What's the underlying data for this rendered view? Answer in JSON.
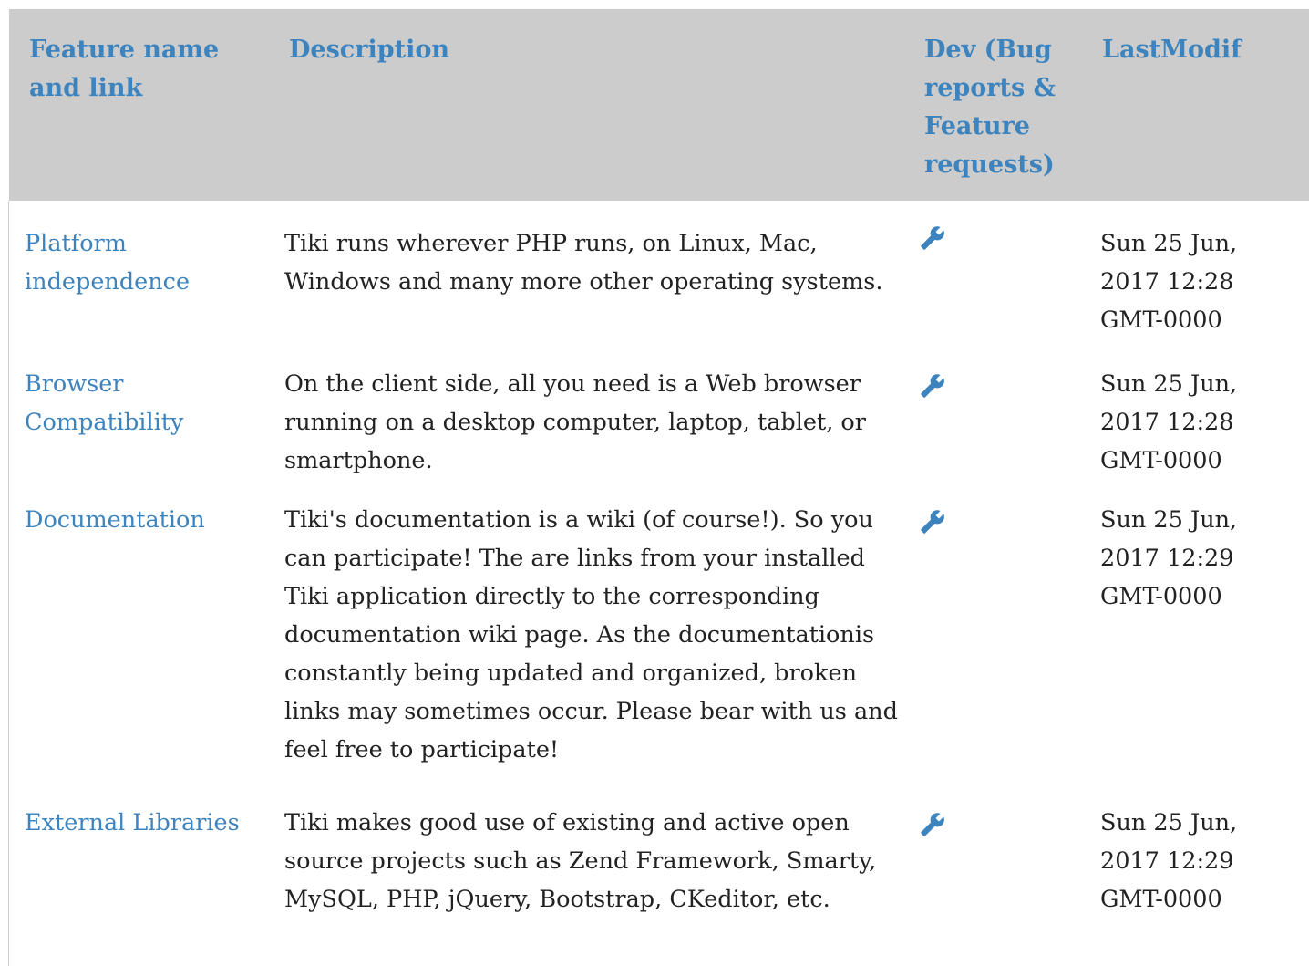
{
  "table": {
    "headers": {
      "name": "Feature name and link",
      "description": "Description",
      "dev": "Dev (Bug reports & Feature requests)",
      "last_modified": "LastModif"
    },
    "rows": [
      {
        "name": "Platform independence",
        "description": "Tiki runs wherever PHP runs, on Linux, Mac, Windows and many more other operating systems.",
        "dev_icon": "wrench-icon",
        "last_modified": "Sun 25 Jun, 2017 12:28 GMT-0000"
      },
      {
        "name": "Browser Compatibility",
        "description": "On the client side, all you need is a Web browser running on a desktop computer, laptop, tablet, or smartphone.",
        "dev_icon": "wrench-icon",
        "last_modified": "Sun 25 Jun, 2017 12:28 GMT-0000"
      },
      {
        "name": "Documentation",
        "description": "Tiki's documentation is a wiki (of course!). So you can participate! The are links from your installed Tiki application directly to the corresponding documentation wiki page. As the documentationis constantly being updated and organized, broken links may sometimes occur. Please bear with us and feel free to participate!",
        "dev_icon": "wrench-icon",
        "last_modified": "Sun 25 Jun, 2017 12:29 GMT-0000"
      },
      {
        "name": "External Libraries",
        "description": "Tiki makes good use of existing and active open source projects such as Zend Framework, Smarty, MySQL, PHP, jQuery, Bootstrap, CKeditor, etc.",
        "dev_icon": "wrench-icon",
        "last_modified": "Sun 25 Jun, 2017 12:29 GMT-0000"
      }
    ]
  },
  "colors": {
    "header_background": "#cccccc",
    "link": "#3d84bf",
    "text": "#222222"
  }
}
